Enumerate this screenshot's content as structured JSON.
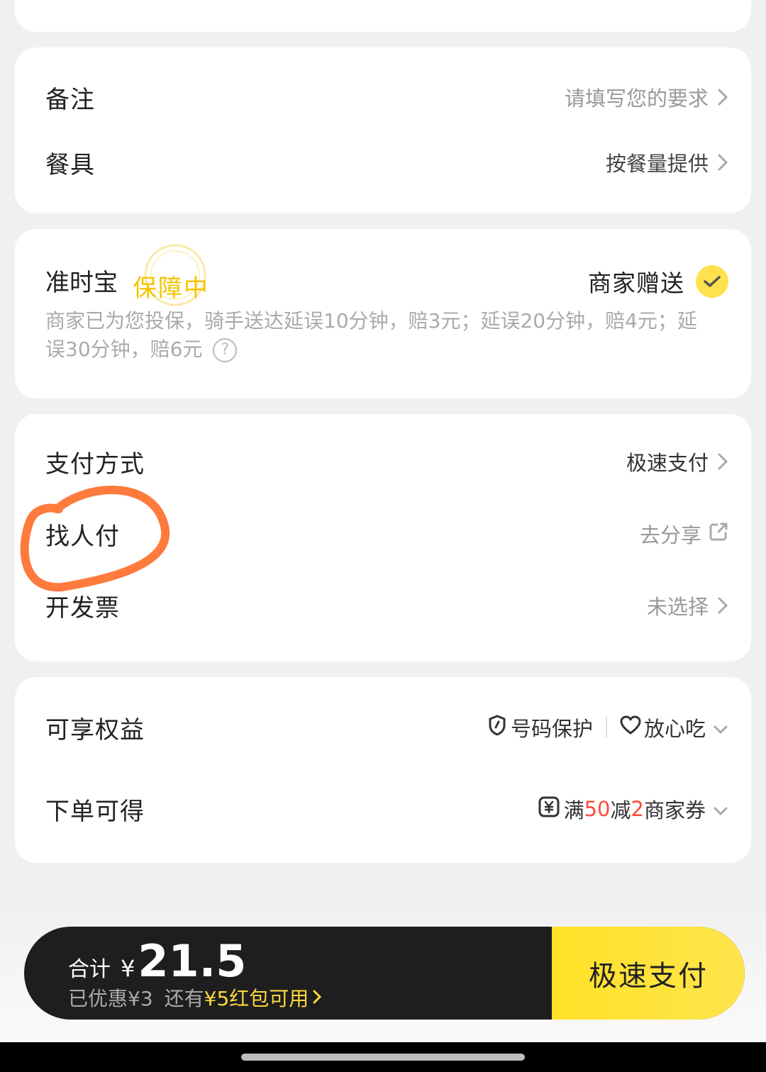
{
  "remarks": {
    "label": "备注",
    "placeholder": "请填写您的要求"
  },
  "utensils": {
    "label": "餐具",
    "value": "按餐量提供"
  },
  "zhunshibao": {
    "title": "准时宝",
    "stamp": "保障中",
    "gift": "商家赠送",
    "desc": "商家已为您投保，骑手送达延误10分钟，赔3元；延误20分钟，赔4元；延误30分钟，赔6元",
    "help_icon": "?"
  },
  "payment": {
    "method_label": "支付方式",
    "method_value": "极速支付",
    "friend_pay_label": "找人付",
    "friend_pay_value": "去分享",
    "invoice_label": "开发票",
    "invoice_value": "未选择"
  },
  "benefits": {
    "label": "可享权益",
    "tag1": "号码保护",
    "tag2": "放心吃",
    "earn_label": "下单可得",
    "coupon_prefix": "满",
    "coupon_threshold": "50",
    "coupon_mid": "减",
    "coupon_amount": "2",
    "coupon_suffix": "商家券"
  },
  "checkout": {
    "total_label": "合计",
    "currency": "¥",
    "total": "21.5",
    "saved": "已优惠¥3",
    "redpacket_prefix": "还有",
    "redpacket": "¥5红包可用",
    "pay_button": "极速支付"
  },
  "colors": {
    "accent_yellow": "#ffe227",
    "coupon_red": "#ff4b33",
    "annotation_orange": "#ff7a3d"
  },
  "icons": {
    "chevron": "chevron-right-icon",
    "share": "share-icon",
    "shield": "shield-icon",
    "heart": "heart-icon",
    "coupon": "yuan-coupon-icon",
    "check": "check-icon"
  }
}
